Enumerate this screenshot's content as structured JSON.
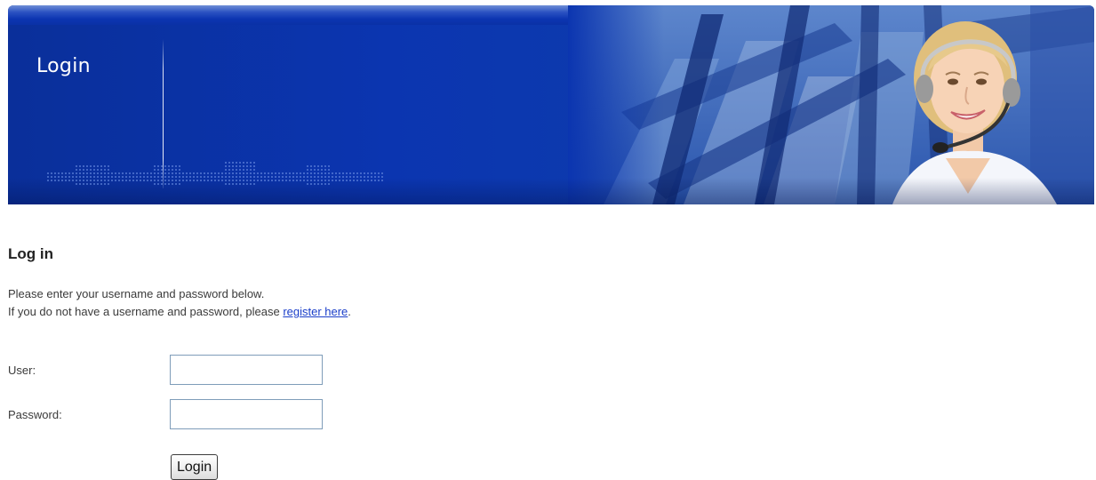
{
  "banner": {
    "title": "Login",
    "icons": [
      "dotted-pattern-decoration",
      "glass-building-image",
      "support-agent-headset-photo"
    ]
  },
  "main": {
    "heading": "Log in",
    "intro_line1": "Please enter your username and password below.",
    "intro_line2_prefix": "If you do not have a username and password, please ",
    "register_link": "register here",
    "intro_line2_suffix": "."
  },
  "form": {
    "user_label": "User:",
    "user_value": "",
    "password_label": "Password:",
    "password_value": "",
    "login_button": "Login"
  },
  "colors": {
    "banner_blue": "#0b35b0",
    "link": "#1a3ec9",
    "input_border": "#7f9db9"
  }
}
